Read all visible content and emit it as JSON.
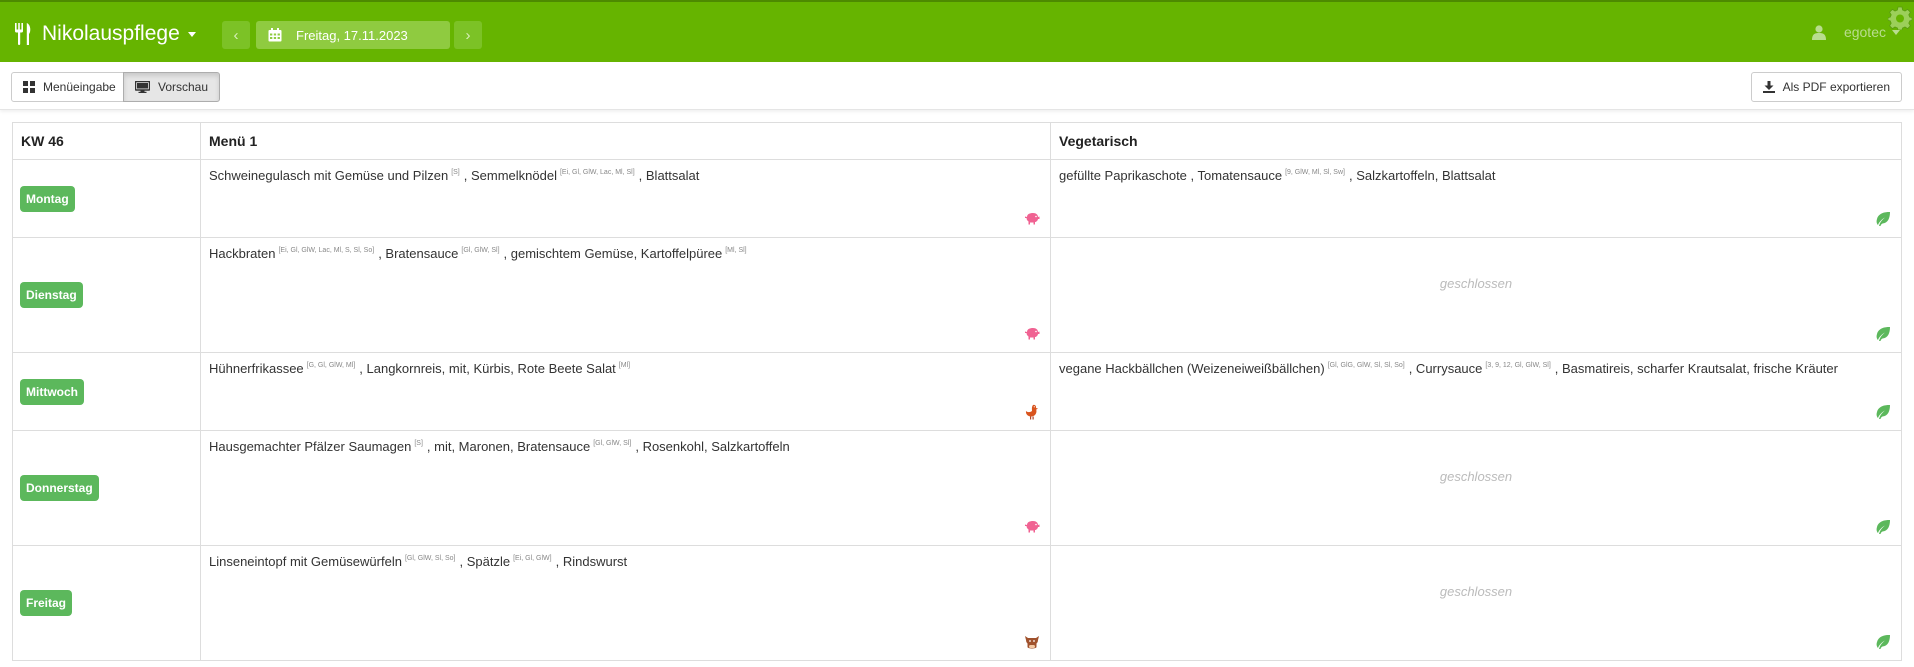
{
  "header": {
    "brand": "Nikolauspflege",
    "date": "Freitag, 17.11.2023",
    "prev": "‹",
    "next": "›",
    "user": "egotec",
    "colors": {
      "bar": "#66b400"
    }
  },
  "toolbar": {
    "input_label": "Menüeingabe",
    "preview_label": "Vorschau",
    "export_label": "Als PDF exportieren"
  },
  "table": {
    "week": "KW 46",
    "col1": "Menü 1",
    "col2": "Vegetarisch",
    "closed_label": "geschlossen",
    "rows": [
      {
        "day": "Montag",
        "menu1": [
          {
            "t": "Schweinegulasch mit Gemüse und Pilzen",
            "a": "[S]"
          },
          {
            "t": ", Semmelknödel",
            "a": "[Ei, Gl, GlW, Lac, Ml, Sl]"
          },
          {
            "t": ", Blattsalat",
            "a": ""
          }
        ],
        "menu1_icon": "pig-icon",
        "veg": [
          {
            "t": "gefüllte Paprikaschote",
            "a": ""
          },
          {
            "t": " , Tomatensauce",
            "a": "[9, GlW, Ml, Sl, Sw]"
          },
          {
            "t": ", Salzkartoffeln, Blattsalat",
            "a": ""
          }
        ],
        "veg_icon": "leaf-icon"
      },
      {
        "day": "Dienstag",
        "menu1": [
          {
            "t": "Hackbraten",
            "a": "[Ei, Gl, GlW, Lac, Ml, S, Sl, So]"
          },
          {
            "t": ", Bratensauce",
            "a": "[Gl, GlW, Sl]"
          },
          {
            "t": ", gemischtem Gemüse, Kartoffelpüree",
            "a": "[Ml, Sl]"
          }
        ],
        "menu1_icon": "pig-icon",
        "veg": [],
        "veg_icon": "leaf-icon"
      },
      {
        "day": "Mittwoch",
        "menu1": [
          {
            "t": "Hühnerfrikassee",
            "a": "[G, Gl, GlW, Ml]"
          },
          {
            "t": ", Langkornreis, mit, Kürbis, Rote Beete Salat",
            "a": "[Ml]"
          }
        ],
        "menu1_icon": "chicken-icon",
        "veg": [
          {
            "t": "vegane Hackbällchen (Weizeneiweißbällchen)",
            "a": "[Gl, GlG, GlW, Sl, Sl, So]"
          },
          {
            "t": ", Currysauce",
            "a": "[3, 9, 12, Gl, GlW, Sl]"
          },
          {
            "t": ", Basmatireis, scharfer Krautsalat, frische Kräuter",
            "a": ""
          }
        ],
        "veg_icon": "leaf-icon"
      },
      {
        "day": "Donnerstag",
        "menu1": [
          {
            "t": "Hausgemachter Pfälzer Saumagen",
            "a": "[S]"
          },
          {
            "t": ", mit, Maronen, Bratensauce",
            "a": "[Gl, GlW, Sl]"
          },
          {
            "t": ", Rosenkohl, Salzkartoffeln",
            "a": ""
          }
        ],
        "menu1_icon": "pig-icon",
        "veg": [],
        "veg_icon": "leaf-icon"
      },
      {
        "day": "Freitag",
        "menu1": [
          {
            "t": "Linseneintopf mit Gemüsewürfeln",
            "a": "[Gl, GlW, Sl, So]"
          },
          {
            "t": ", Spätzle",
            "a": "[Ei, Gl, GlW]"
          },
          {
            "t": ", Rindswurst",
            "a": ""
          }
        ],
        "menu1_icon": "cow-icon",
        "veg": [],
        "veg_icon": "leaf-icon"
      }
    ]
  }
}
